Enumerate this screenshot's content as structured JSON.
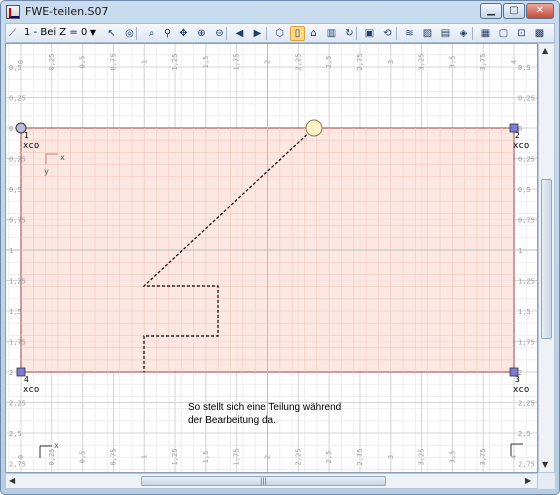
{
  "window": {
    "title": "FWE-teilen.S07"
  },
  "toolbar": {
    "loadcase": "1 - Bei Z = 0",
    "tools": [
      {
        "name": "select-arrow-icon",
        "glyph": "↖",
        "active": false
      },
      {
        "name": "select-region-icon",
        "glyph": "◎",
        "active": false
      },
      {
        "name": "zoom-icon",
        "glyph": "⌕",
        "active": false
      },
      {
        "name": "zoom-window-icon",
        "glyph": "⚲",
        "active": false
      },
      {
        "name": "pan-icon",
        "glyph": "✥",
        "active": false
      },
      {
        "name": "zoom-in-icon",
        "glyph": "⊕",
        "active": false
      },
      {
        "name": "zoom-out-icon",
        "glyph": "⊖",
        "active": false
      },
      {
        "name": "back-icon",
        "glyph": "◀",
        "active": false
      },
      {
        "name": "forward-icon",
        "glyph": "▶",
        "active": false
      },
      {
        "name": "view-3d-icon",
        "glyph": "⬡",
        "active": false
      },
      {
        "name": "view-plan-icon",
        "glyph": "▯",
        "active": true
      },
      {
        "name": "home-view-icon",
        "glyph": "⌂",
        "active": false
      },
      {
        "name": "building-icon",
        "glyph": "▥",
        "active": false
      },
      {
        "name": "refresh-icon",
        "glyph": "↻",
        "active": false
      },
      {
        "name": "render-icon",
        "glyph": "▣",
        "active": false
      },
      {
        "name": "rotate-icon",
        "glyph": "⟲",
        "active": false
      },
      {
        "name": "curves-icon",
        "glyph": "≋",
        "active": false
      },
      {
        "name": "image-icon",
        "glyph": "▨",
        "active": false
      },
      {
        "name": "layers-icon",
        "glyph": "▤",
        "active": false
      },
      {
        "name": "rainbow-icon",
        "glyph": "◈",
        "active": false
      },
      {
        "name": "grid-icon",
        "glyph": "▦",
        "active": false
      },
      {
        "name": "window-icon",
        "glyph": "▢",
        "active": false
      },
      {
        "name": "fit-icon",
        "glyph": "⊡",
        "active": false
      },
      {
        "name": "chart-icon",
        "glyph": "▩",
        "active": false
      }
    ]
  },
  "nodes": [
    {
      "id": "1",
      "xco": "xco"
    },
    {
      "id": "2",
      "xco": "xco"
    },
    {
      "id": "4",
      "xco": "xco"
    },
    {
      "id": "3",
      "xco": "xco"
    }
  ],
  "ruler": {
    "left_labels": [
      "0,5",
      "0,25",
      "0",
      "0,25",
      "0,5",
      "0,75",
      "1",
      "1,25",
      "1,5",
      "1,75",
      "2",
      "2,25",
      "2,5",
      "2,75"
    ],
    "right_labels": [
      "0,5",
      "0,25",
      "0",
      "0,25",
      "0,5",
      "0,75",
      "1",
      "1,25",
      "1,5",
      "1,75",
      "2",
      "2,25",
      "2,5",
      "2,75"
    ],
    "top_labels": [
      "0,5",
      "0,25",
      "0",
      "0,25",
      "0,5",
      "0,75",
      "1",
      "1,25",
      "1,5",
      "1,75",
      "2",
      "2,25",
      "2,5",
      "2,75",
      "3",
      "3,25",
      "3,5",
      "3,75",
      "4"
    ],
    "bottom_labels": [
      "0,5",
      "0,25",
      "0",
      "0,25",
      "0,5",
      "0,75",
      "1",
      "1,25",
      "1,5",
      "1,75",
      "2",
      "2,25",
      "2,5",
      "2,75",
      "3",
      "3,25",
      "3,5",
      "3,75",
      "4"
    ]
  },
  "axes": {
    "x": "x",
    "y": "y"
  },
  "caption": {
    "line1": "So stellt sich eine Teilung während",
    "line2": "der Bearbeitung da."
  },
  "colors": {
    "panel_fill": "#fbe3dd",
    "panel_border": "#a04040",
    "node_fill": "#7c7cd8",
    "grip_fill": "#fff4c8"
  }
}
